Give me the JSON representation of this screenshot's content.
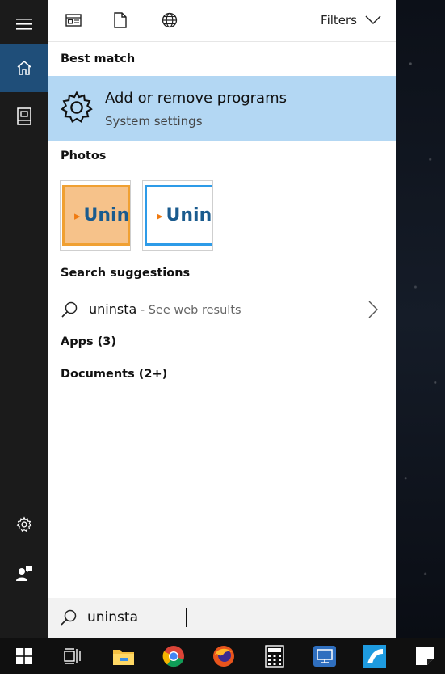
{
  "filters_label": "Filters",
  "best_match": {
    "section_label": "Best match",
    "title": "Add or remove programs",
    "subtitle": "System settings",
    "icon": "gear-icon"
  },
  "photos": {
    "section_label": "Photos",
    "items": [
      {
        "text": "Unins"
      },
      {
        "text": "Unin"
      }
    ]
  },
  "suggestions": {
    "section_label": "Search suggestions",
    "query": "uninsta",
    "hint": " - See web results"
  },
  "groups": {
    "apps": "Apps (3)",
    "documents": "Documents (2+)"
  },
  "search": {
    "value": "uninsta"
  },
  "colors": {
    "accent": "#1f4e79",
    "best_match_bg": "#b3d7f3",
    "rail_bg": "#1b1b1b",
    "taskbar_bg": "#101010"
  },
  "rail_icons": [
    "hamburger-menu-icon",
    "home-icon",
    "notebook-icon",
    "settings-icon",
    "feedback-icon"
  ],
  "taskbar_icons": [
    "windows-start-icon",
    "task-view-icon",
    "file-explorer-icon",
    "chrome-icon",
    "firefox-icon",
    "calculator-icon",
    "remote-desktop-icon",
    "app-icon",
    "sticky-notes-icon"
  ]
}
